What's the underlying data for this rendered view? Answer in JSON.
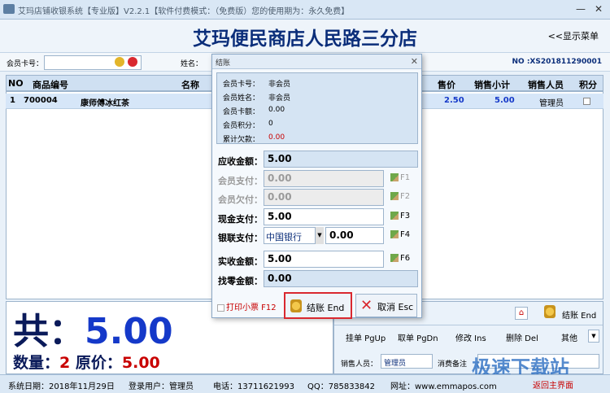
{
  "window": {
    "title": "艾玛店铺收银系统【专业版】V2.2.1【软件付费模式：（免费版）您的使用期为：永久免费】",
    "minimize": "—",
    "close": "✕"
  },
  "header": {
    "store_name": "艾玛便民商店人民路三分店",
    "show_menu": "<<显示菜单"
  },
  "infobar": {
    "card_label": "会员卡号：",
    "name_label": "姓名：",
    "order_no": "NO :XS201811290001"
  },
  "grid": {
    "headers": {
      "no": "NO",
      "code": "商品编号",
      "name": "名称",
      "price": "售价",
      "subtotal": "销售小计",
      "staff": "销售人员",
      "points": "积分"
    },
    "rows": [
      {
        "no": "1",
        "code": "700004",
        "name": "康师傅冰红茶",
        "price": "2.50",
        "subtotal": "5.00",
        "staff": "管理员"
      }
    ]
  },
  "totals": {
    "total_prefix": "共：",
    "total_value": "5.00",
    "qty_label": "数量：",
    "qty_value": "2",
    "orig_label": " 原价：",
    "orig_value": "5.00"
  },
  "actions": {
    "settle": "结账 End",
    "pgup": "挂单 PgUp",
    "pgdn": "取单 PgDn",
    "ins": "修改 Ins",
    "del": "删除 Del",
    "other": "其他",
    "staff_label": "销售人员：",
    "staff_value": "管理员",
    "note_label": "消费备注"
  },
  "status": {
    "date": "系统日期：2018年11月29日",
    "user": "登录用户：管理员",
    "phone": "电话：13711621993",
    "qq": "QQ：785833842",
    "web": "网址：www.emmapos.com",
    "home": "返回主界面"
  },
  "dialog": {
    "title": "结账",
    "member": [
      {
        "label": "会员卡号：",
        "value": "非会员"
      },
      {
        "label": "会员姓名：",
        "value": "非会员"
      },
      {
        "label": "会员卡额：",
        "value": "0.00"
      },
      {
        "label": "会员积分：",
        "value": "0"
      },
      {
        "label": "累计欠款：",
        "value": "0.00"
      }
    ],
    "receivable_label": "应收金额：",
    "receivable_value": "5.00",
    "member_pay_label": "会员支付：",
    "member_pay_value": "0.00",
    "member_pay_key": "F1",
    "member_debt_label": "会员欠付：",
    "member_debt_value": "0.00",
    "member_debt_key": "F2",
    "cash_label": "现金支付：",
    "cash_value": "5.00",
    "cash_key": "F3",
    "union_label": "银联支付：",
    "union_bank": "中国银行",
    "union_value": "0.00",
    "union_key": "F4",
    "actual_label": "实收金额：",
    "actual_value": "5.00",
    "actual_key": "F6",
    "change_label": "找零金额：",
    "change_value": "0.00",
    "print_label": "打印小票 F12",
    "settle_button": "结账 End",
    "cancel_button": "取消 Esc"
  },
  "watermark": "极速下载站",
  "colors": {
    "accent": "#0b2e7a",
    "total_blue": "#1539c9",
    "alert_red": "#c80000",
    "highlight_border": "#d9282f"
  }
}
